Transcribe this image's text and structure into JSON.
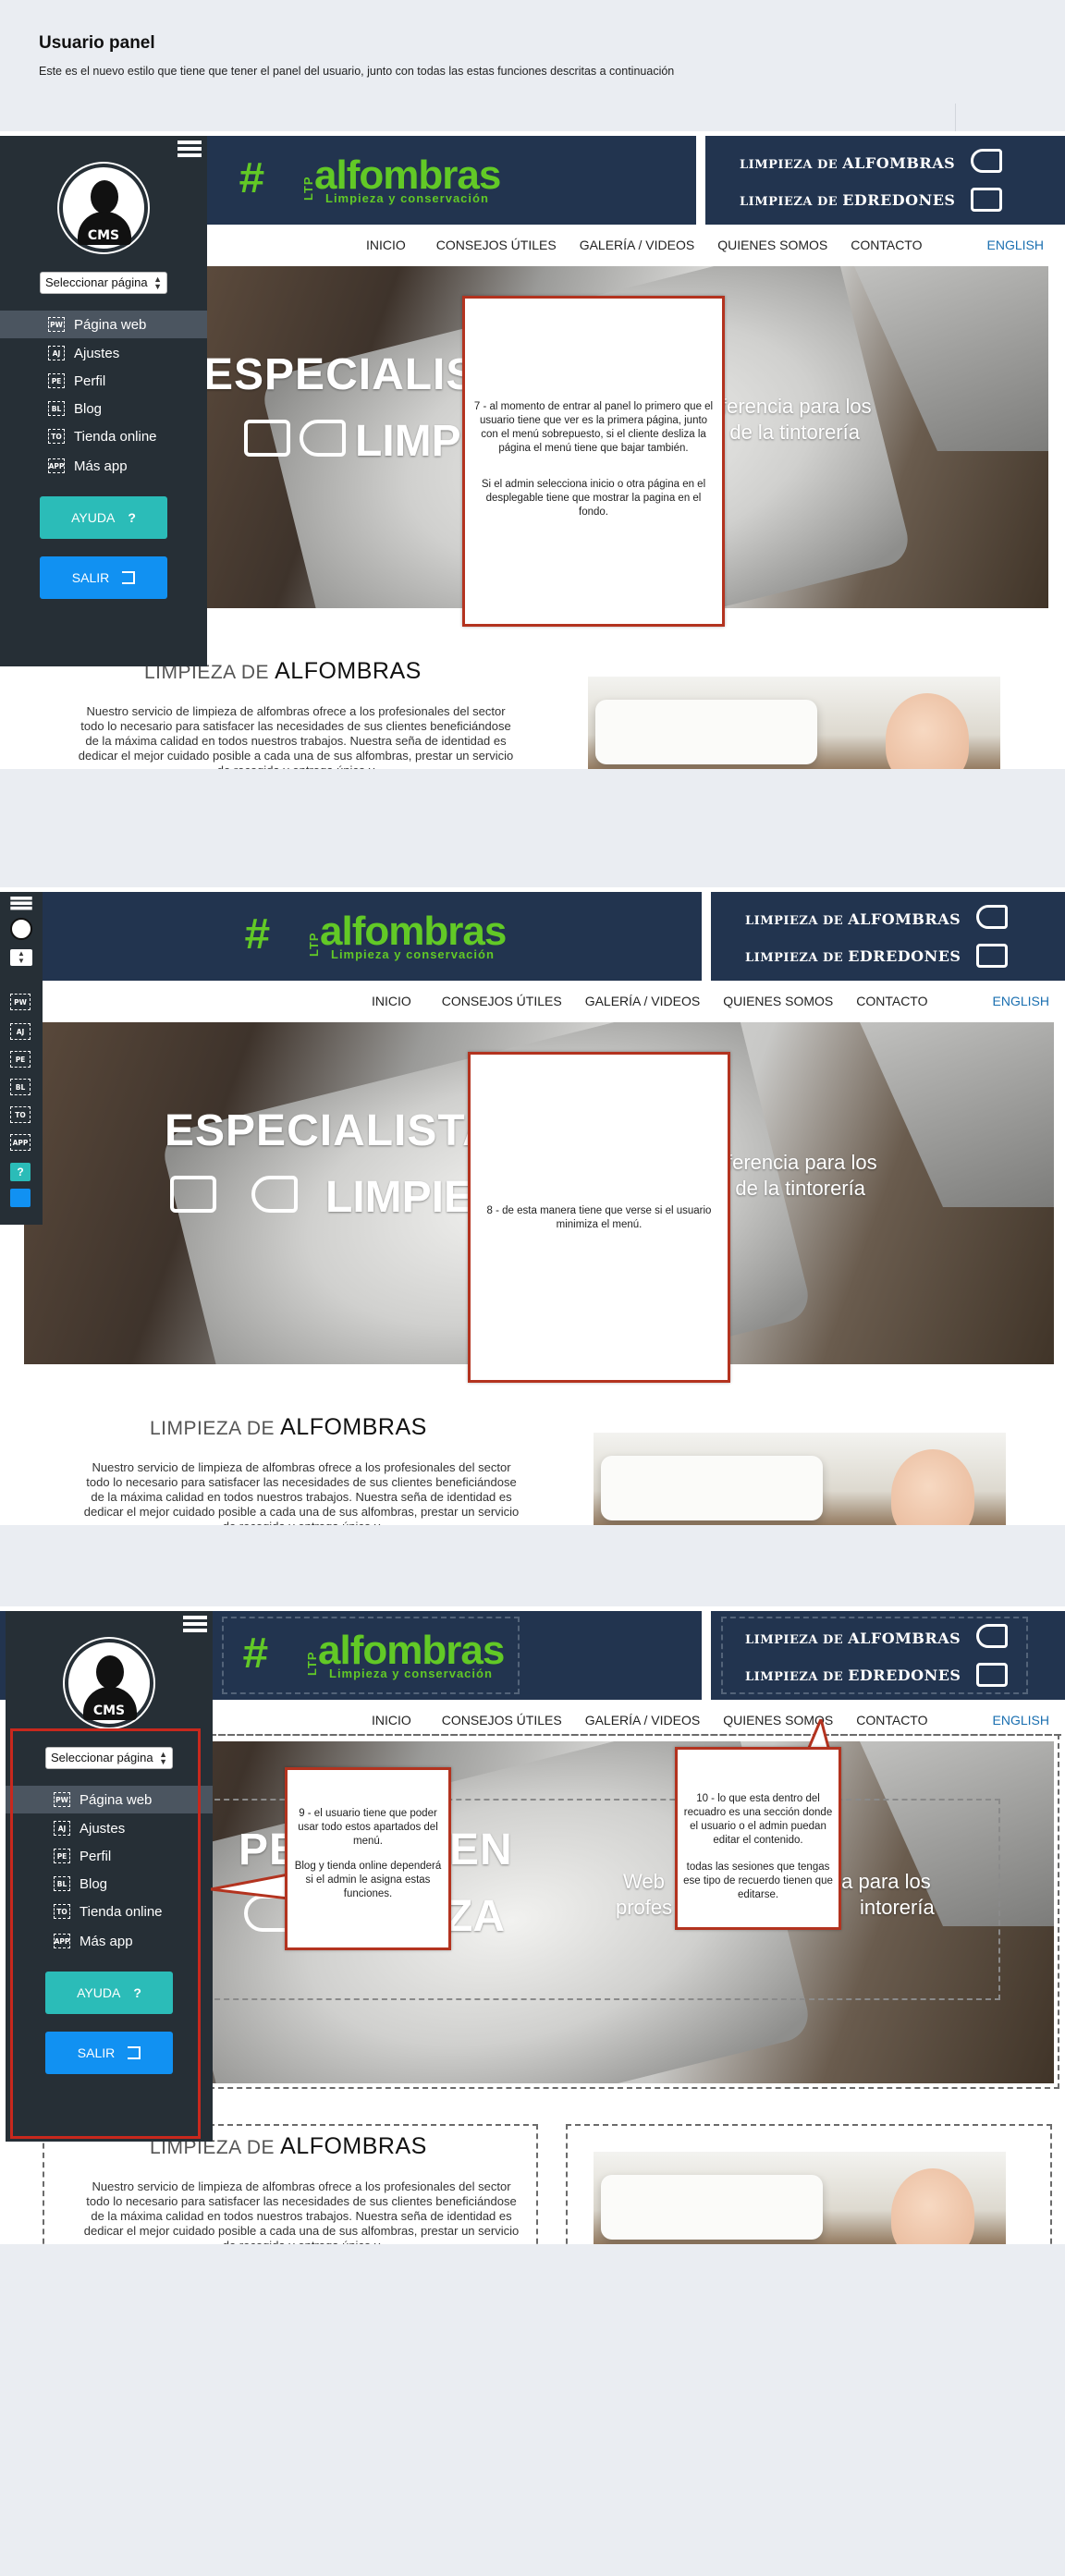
{
  "page": {
    "title": "Usuario panel",
    "subtitle": "Este es el nuevo estilo que tiene que tener el panel del usuario, junto con todas las estas funciones descritas a continuación"
  },
  "site": {
    "logo_ltp": "LTP",
    "logo_name": "alfombras",
    "logo_tagline": "Limpieza y conservación",
    "services": [
      {
        "pre": "LIMPIEZA DE",
        "main": "ALFOMBRAS"
      },
      {
        "pre": "LIMPIEZA DE",
        "main": "EDREDONES"
      }
    ],
    "nav": [
      "INICIO",
      "CONSEJOS ÚTILES",
      "GALERÍA / VIDEOS",
      "QUIENES SOMOS",
      "CONTACTO"
    ],
    "nav_lang": "ENGLISH",
    "hero_line1": "ESPECIALISTAS E",
    "hero_line2": "LIMPIEZ",
    "hero_text1": "ferencia para los",
    "hero_text2": "es de la tintorería",
    "hero3_line1": "PEC",
    "hero3_line1b": "EN",
    "hero3_line2": "ZA",
    "hero3_text1": "Web",
    "hero3_text1b": "ncia para los",
    "hero3_text2": "profes",
    "hero3_text2b": "intorería",
    "section_pre": "LIMPIEZA DE",
    "section_main": "ALFOMBRAS",
    "section_body": "Nuestro servicio de limpieza de alfombras ofrece a los profesionales del sector todo lo necesario para satisfacer las necesidades de sus clientes beneficiándose de la máxima calidad en todos nuestros trabajos. Nuestra seña de identidad es dedicar el mejor cuidado posible a cada una de sus alfombras, prestar un servicio de recogida y entrega único y"
  },
  "panel": {
    "avatar_label": "CMS",
    "select_label": "Seleccionar página",
    "menu": [
      {
        "badge": "PW",
        "label": "Página web"
      },
      {
        "badge": "AJ",
        "label": "Ajustes"
      },
      {
        "badge": "PE",
        "label": "Perfil"
      },
      {
        "badge": "BL",
        "label": "Blog"
      },
      {
        "badge": "TO",
        "label": "Tienda online"
      },
      {
        "badge": "APP",
        "label": "Más app"
      }
    ],
    "help_label": "AYUDA",
    "help_icon": "?",
    "exit_label": "SALIR",
    "exit_icon": "exit-icon"
  },
  "notes": {
    "n7a": "7 - al momento de entrar al panel lo primero que el usuario tiene que ver es la primera página, junto con el menú sobrepuesto, si el cliente desliza la página el menú tiene que bajar también.",
    "n7b": "Si el admin selecciona inicio o otra página en el desplegable tiene que mostrar la pagina en el fondo.",
    "n8": "8 - de esta manera tiene que verse si el usuario minimiza el menú.",
    "n9a": "9 - el usuario tiene que poder usar todo estos apartados del menú.",
    "n9b": "Blog y tienda online dependerá si el admin le asigna estas funciones.",
    "n10a": "10 - lo que esta dentro del recuadro es una sección donde el usuario o el admin puedan editar el contenido.",
    "n10b": "todas las sesiones que tengas ese tipo de recuerdo tienen que editarse."
  },
  "colors": {
    "panel_bg": "#262f36",
    "active_item": "#4b5560",
    "help": "#2bbcb8",
    "exit": "#1191f2",
    "banner": "#22344f",
    "brand_green": "#62c926",
    "note_border": "#b3331f",
    "english_link": "#1a6fb0"
  }
}
